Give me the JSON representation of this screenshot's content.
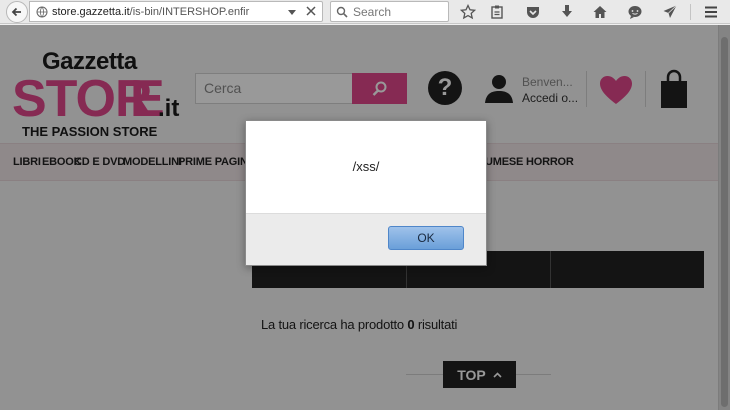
{
  "browser": {
    "url_host": "store.gazzetta.it",
    "url_path": "/is-bin/INTERSHOP.enfir",
    "search_placeholder": "Search"
  },
  "header": {
    "logo_line1": "Gazzetta",
    "logo_line2": "STORE.it",
    "logo_tagline": "THE PASSION STORE",
    "search_placeholder": "Cerca",
    "help_glyph": "?",
    "welcome": "Benven...",
    "login": "Accedi o..."
  },
  "nav": {
    "items": [
      "LIBRI",
      "EBOOK",
      "CD E DVD",
      "MODELLINI",
      "PRIME PAGIN"
    ],
    "right_item": "UMESE HORROR"
  },
  "results": {
    "prefix": "La tua ricerca ha prodotto",
    "count": "0",
    "suffix": "risultati"
  },
  "top_button": "TOP",
  "dialog": {
    "message": "/xss/",
    "ok_label": "OK"
  },
  "colors": {
    "brand_pink": "#e0468a",
    "dark": "#222222",
    "ok_blue": "#6a9fd9"
  }
}
